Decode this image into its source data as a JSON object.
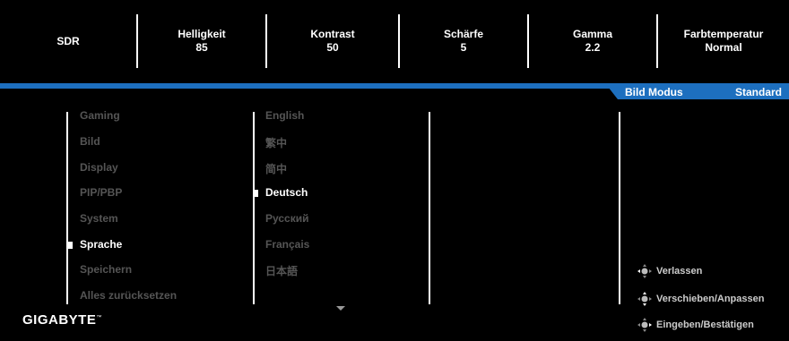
{
  "status": {
    "sdr": "SDR",
    "items": [
      {
        "label": "Helligkeit",
        "value": "85"
      },
      {
        "label": "Kontrast",
        "value": "50"
      },
      {
        "label": "Schärfe",
        "value": "5"
      },
      {
        "label": "Gamma",
        "value": "2.2"
      },
      {
        "label": "Farbtemperatur",
        "value": "Normal"
      }
    ]
  },
  "mode": {
    "label": "Bild Modus",
    "value": "Standard"
  },
  "main_menu": [
    "Gaming",
    "Bild",
    "Display",
    "PIP/PBP",
    "System",
    "Sprache",
    "Speichern",
    "Alles zurücksetzen"
  ],
  "languages": [
    "English",
    "繁中",
    "简中",
    "Deutsch",
    "Русский",
    "Français",
    "日本語"
  ],
  "hints": [
    "Verlassen",
    "Verschieben/Anpassen",
    "Eingeben/Bestätigen"
  ],
  "brand": {
    "logo": "GIGABYTE",
    "tm": "™"
  },
  "colors": {
    "accent": "#1d6fbf",
    "inactive": "#555555"
  }
}
